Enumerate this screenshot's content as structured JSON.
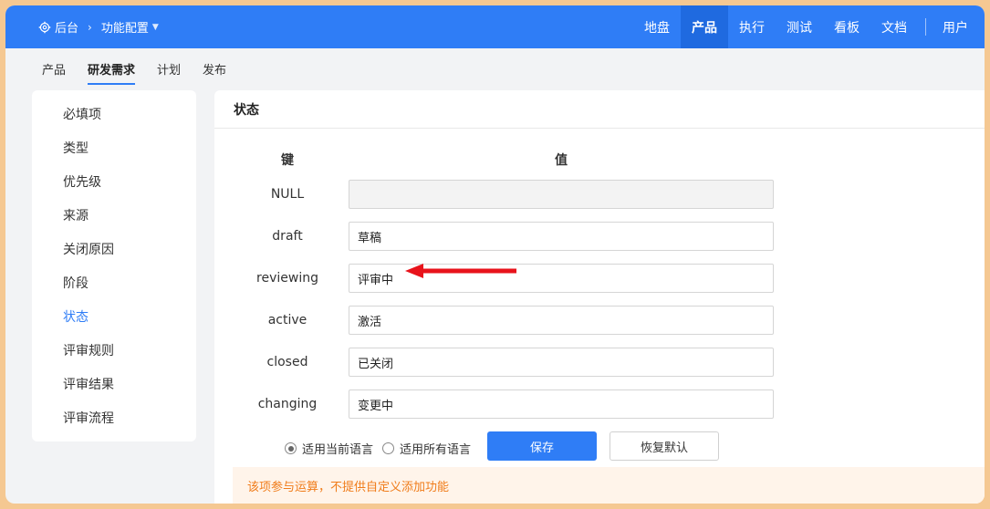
{
  "breadcrumb": {
    "root": "后台",
    "separator": "›",
    "current": "功能配置"
  },
  "nav": {
    "items": [
      {
        "label": "地盘",
        "active": false
      },
      {
        "label": "产品",
        "active": true
      },
      {
        "label": "执行",
        "active": false
      },
      {
        "label": "测试",
        "active": false
      },
      {
        "label": "看板",
        "active": false
      },
      {
        "label": "文档",
        "active": false
      }
    ],
    "user": "用户"
  },
  "subnav": {
    "tabs": [
      {
        "label": "产品",
        "active": false
      },
      {
        "label": "研发需求",
        "active": true
      },
      {
        "label": "计划",
        "active": false
      },
      {
        "label": "发布",
        "active": false
      }
    ]
  },
  "sidebar": {
    "items": [
      {
        "label": "必填项"
      },
      {
        "label": "类型"
      },
      {
        "label": "优先级"
      },
      {
        "label": "来源"
      },
      {
        "label": "关闭原因"
      },
      {
        "label": "阶段"
      },
      {
        "label": "状态",
        "active": true
      },
      {
        "label": "评审规则"
      },
      {
        "label": "评审结果"
      },
      {
        "label": "评审流程"
      }
    ]
  },
  "panel": {
    "title": "状态",
    "key_header": "键",
    "value_header": "值",
    "rows": [
      {
        "key": "NULL",
        "value": ""
      },
      {
        "key": "draft",
        "value": "草稿"
      },
      {
        "key": "reviewing",
        "value": "评审中"
      },
      {
        "key": "active",
        "value": "激活"
      },
      {
        "key": "closed",
        "value": "已关闭"
      },
      {
        "key": "changing",
        "value": "变更中"
      }
    ],
    "radio_current": "适用当前语言",
    "radio_all": "适用所有语言",
    "save": "保存",
    "reset": "恢复默认",
    "notice": "该项参与运算，不提供自定义添加功能"
  },
  "colors": {
    "primary": "#2f7df6",
    "notice_text": "#f07c1a",
    "notice_bg": "#fff4ea",
    "arrow": "#e8131b"
  },
  "icons": {
    "settings": "gear-icon",
    "breadcrumb_sep": "chevron-right-icon",
    "dropdown": "caret-down-icon",
    "annotation": "red-arrow-icon"
  }
}
